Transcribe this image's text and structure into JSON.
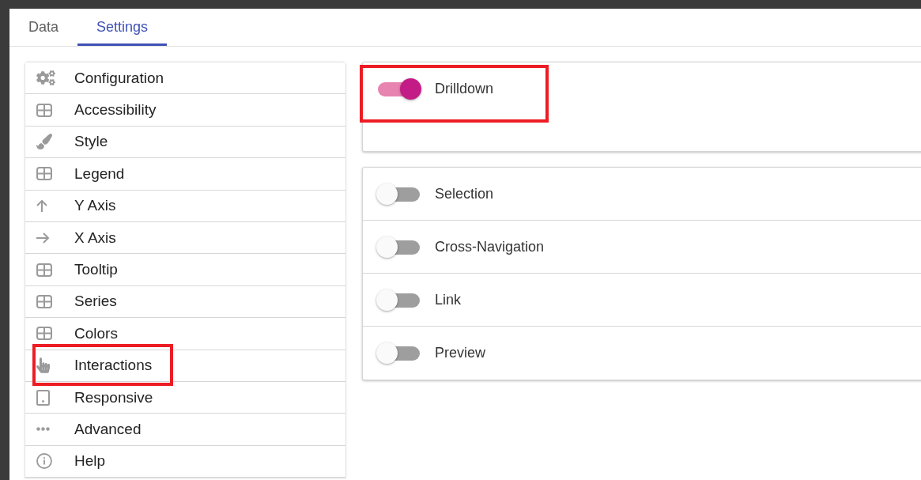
{
  "tabs": [
    {
      "label": "Data",
      "selected": false
    },
    {
      "label": "Settings",
      "selected": true
    }
  ],
  "sidebar": {
    "items": [
      {
        "label": "Configuration",
        "kind": "gears",
        "highlighted": false
      },
      {
        "label": "Accessibility",
        "kind": "grid",
        "highlighted": false
      },
      {
        "label": "Style",
        "kind": "brush",
        "highlighted": false
      },
      {
        "label": "Legend",
        "kind": "grid",
        "highlighted": false
      },
      {
        "label": "Y Axis",
        "kind": "arrow-up",
        "highlighted": false
      },
      {
        "label": "X Axis",
        "kind": "arrow-right",
        "highlighted": false
      },
      {
        "label": "Tooltip",
        "kind": "grid",
        "highlighted": false
      },
      {
        "label": "Series",
        "kind": "grid",
        "highlighted": false
      },
      {
        "label": "Colors",
        "kind": "grid",
        "highlighted": false
      },
      {
        "label": "Interactions",
        "kind": "hand",
        "highlighted": true
      },
      {
        "label": "Responsive",
        "kind": "tablet",
        "highlighted": false
      },
      {
        "label": "Advanced",
        "kind": "dots",
        "highlighted": false
      },
      {
        "label": "Help",
        "kind": "info",
        "highlighted": false
      }
    ]
  },
  "panels": [
    {
      "rows": [
        {
          "label": "Drilldown",
          "on": true,
          "highlighted": true
        }
      ]
    },
    {
      "rows": [
        {
          "label": "Selection",
          "on": false,
          "highlighted": false
        },
        {
          "label": "Cross-Navigation",
          "on": false,
          "highlighted": false
        },
        {
          "label": "Link",
          "on": false,
          "highlighted": false
        },
        {
          "label": "Preview",
          "on": false,
          "highlighted": false
        }
      ]
    }
  ]
}
